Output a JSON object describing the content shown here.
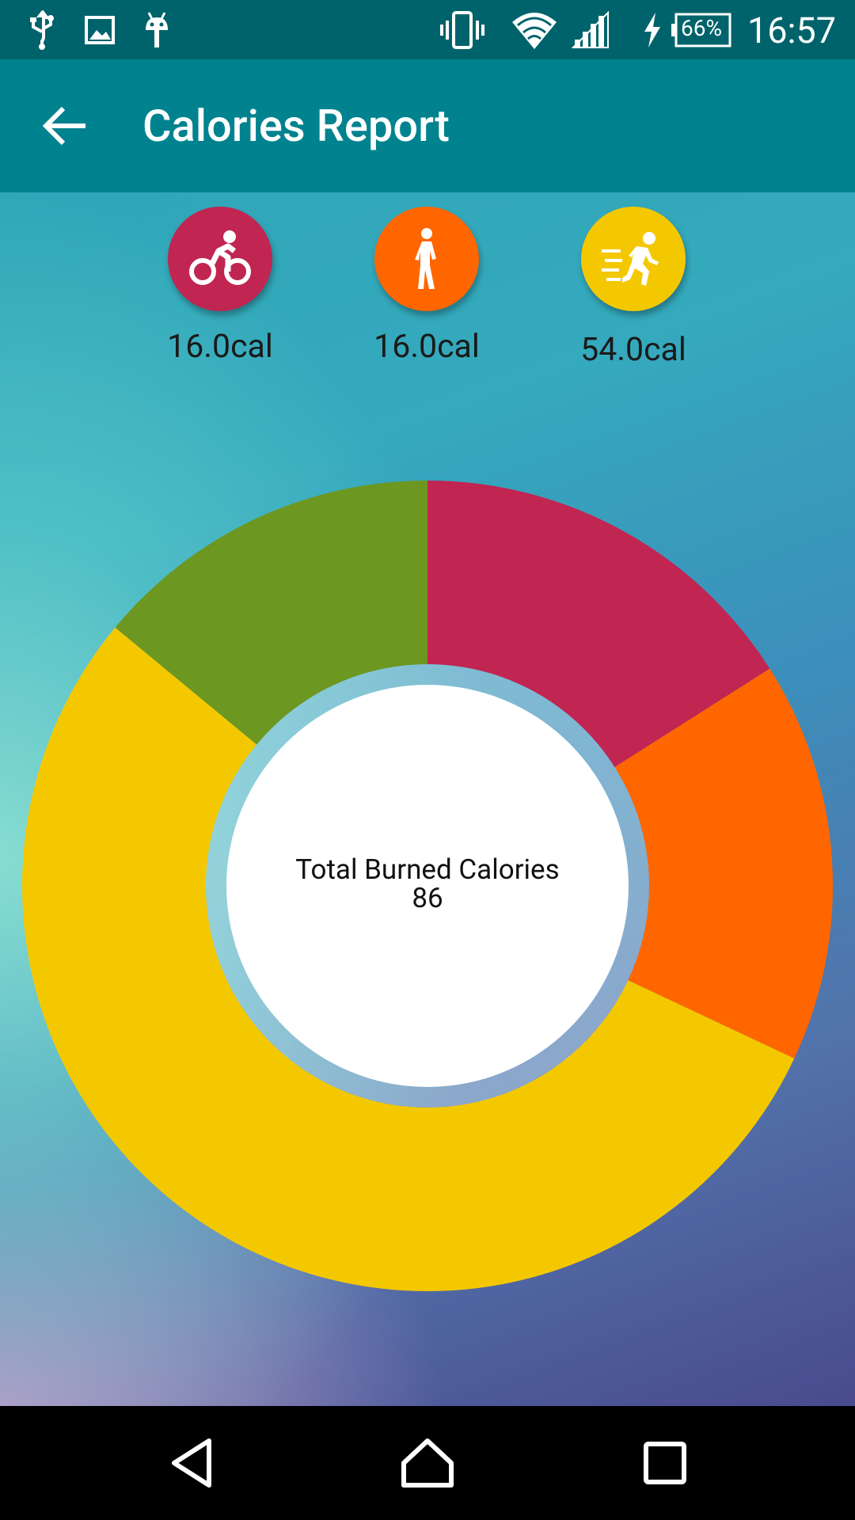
{
  "status_bar": {
    "time": "16:57",
    "battery": "66%",
    "icons_left": [
      "usb-icon",
      "image-icon",
      "android-icon"
    ],
    "icons_right": [
      "vibrate-icon",
      "wifi-icon",
      "signal-icon",
      "charging-icon",
      "battery-icon"
    ]
  },
  "app_bar": {
    "title": "Calories Report",
    "back_icon": "arrow-back-icon"
  },
  "activities": [
    {
      "name": "cycling",
      "icon": "bicycle-icon",
      "value": "16.0cal",
      "color": "#c12552"
    },
    {
      "name": "walking",
      "icon": "walking-icon",
      "value": "16.0cal",
      "color": "#ff6600"
    },
    {
      "name": "running",
      "icon": "running-icon",
      "value": "54.0cal",
      "color": "#f4c800"
    }
  ],
  "chart_data": {
    "type": "pie",
    "style": "donut",
    "center_title": "Total Burned Calories",
    "center_value": "86",
    "slices": [
      {
        "value": 16.0,
        "color": "#c12552"
      },
      {
        "value": 16.0,
        "color": "#ff6600"
      },
      {
        "value": 54.0,
        "color": "#f4c800"
      },
      {
        "value": 14.0,
        "color": "#6c9720"
      }
    ]
  },
  "nav_bar": {
    "icons": [
      "back-triangle-icon",
      "home-icon",
      "recents-square-icon"
    ]
  }
}
